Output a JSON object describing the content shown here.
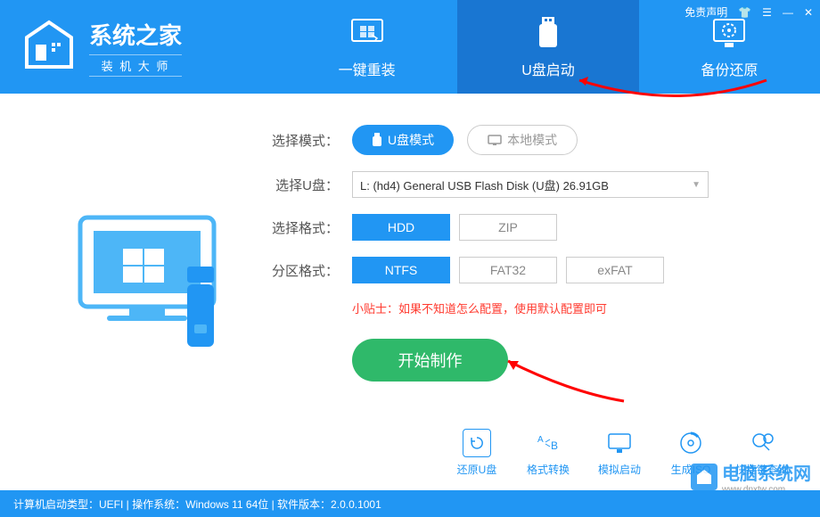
{
  "header": {
    "logo_title": "系统之家",
    "logo_subtitle": "装 机 大 师",
    "disclaimer": "免责声明"
  },
  "tabs": [
    {
      "label": "一键重装",
      "active": false
    },
    {
      "label": "U盘启动",
      "active": true
    },
    {
      "label": "备份还原",
      "active": false
    }
  ],
  "mode": {
    "label": "选择模式：",
    "usb": "U盘模式",
    "local": "本地模式"
  },
  "usb_select": {
    "label": "选择U盘：",
    "value": "L: (hd4) General USB Flash Disk  (U盘) 26.91GB"
  },
  "format": {
    "label": "选择格式：",
    "options": [
      "HDD",
      "ZIP"
    ],
    "selected": "HDD"
  },
  "partition": {
    "label": "分区格式：",
    "options": [
      "NTFS",
      "FAT32",
      "exFAT"
    ],
    "selected": "NTFS"
  },
  "tip": "小贴士：如果不知道怎么配置，使用默认配置即可",
  "start_button": "开始制作",
  "tools": [
    {
      "label": "还原U盘"
    },
    {
      "label": "格式转换"
    },
    {
      "label": "模拟启动"
    },
    {
      "label": "生成ISO"
    },
    {
      "label": "快捷键查询"
    }
  ],
  "status_bar": "计算机启动类型：UEFI | 操作系统：Windows 11 64位 | 软件版本：2.0.0.1001",
  "watermark": {
    "title": "电脑系统网",
    "url": "www.dnxtw.com"
  }
}
